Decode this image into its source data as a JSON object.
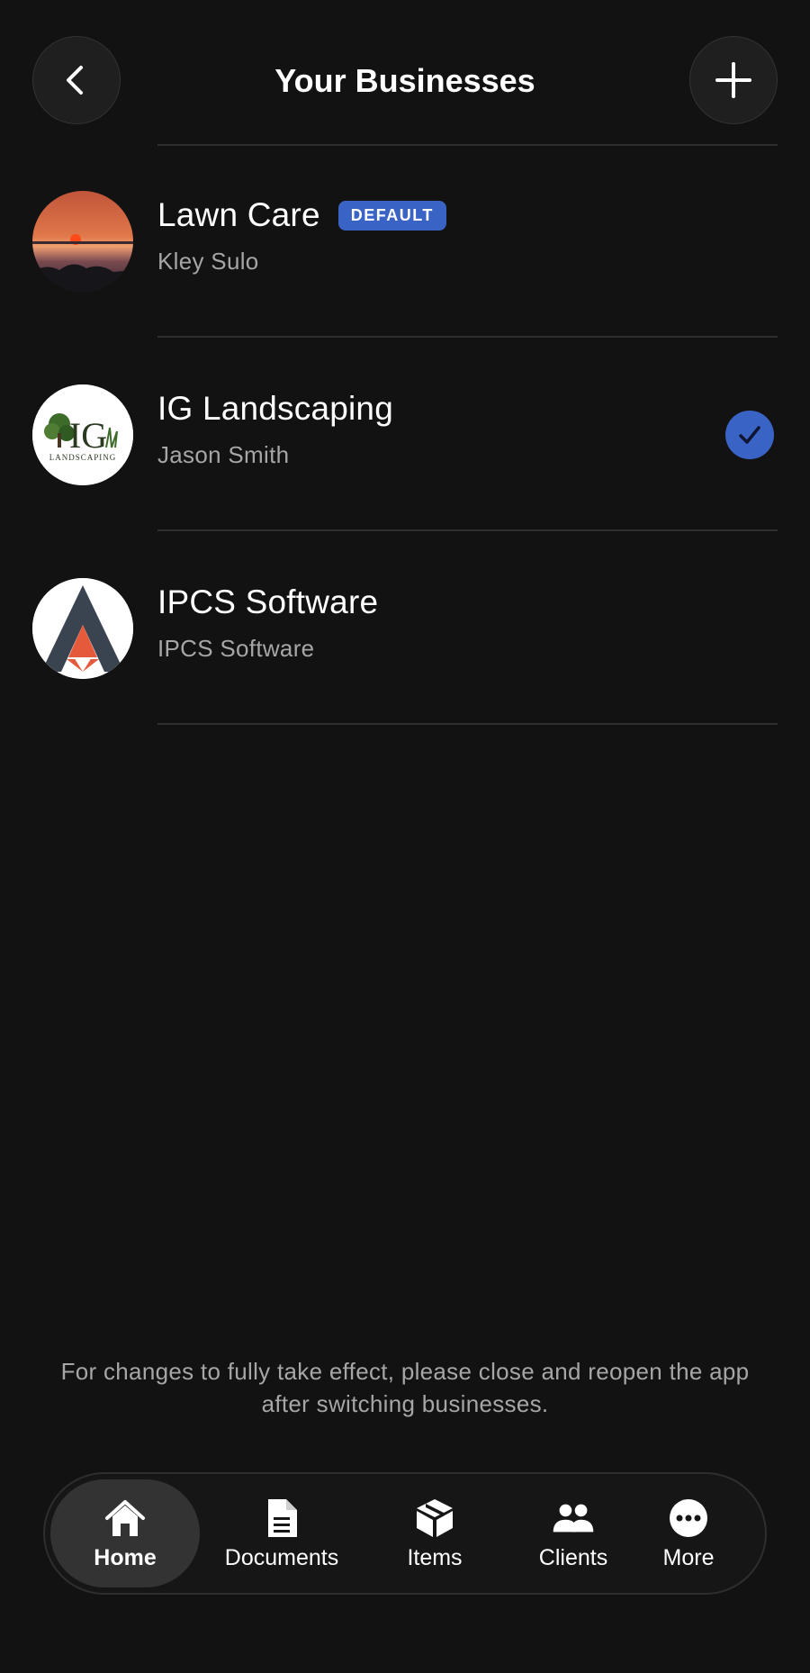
{
  "header": {
    "title": "Your Businesses",
    "back_icon": "chevron-left-icon",
    "add_icon": "plus-icon"
  },
  "businesses": [
    {
      "name": "Lawn Care",
      "owner": "Kley Sulo",
      "badge": "DEFAULT",
      "avatar": "sunset-photo",
      "selected": false
    },
    {
      "name": "IG Landscaping",
      "owner": "Jason Smith",
      "badge": "",
      "avatar": "ig-landscaping-logo",
      "logo_text": "IG",
      "logo_subtext": "LANDSCAPING",
      "selected": true
    },
    {
      "name": "IPCS Software",
      "owner": "IPCS Software",
      "badge": "",
      "avatar": "ipcs-logo",
      "selected": false
    }
  ],
  "note": "For changes to fully take effect, please close and reopen the app after switching businesses.",
  "tabs": [
    {
      "label": "Home",
      "icon": "home-icon",
      "active": true
    },
    {
      "label": "Documents",
      "icon": "document-icon",
      "active": false
    },
    {
      "label": "Items",
      "icon": "box-icon",
      "active": false
    },
    {
      "label": "Clients",
      "icon": "people-icon",
      "active": false
    },
    {
      "label": "More",
      "icon": "more-icon",
      "active": false
    }
  ],
  "colors": {
    "background": "#121212",
    "accent": "#3a63c6",
    "secondary_text": "#a6a6a6"
  }
}
